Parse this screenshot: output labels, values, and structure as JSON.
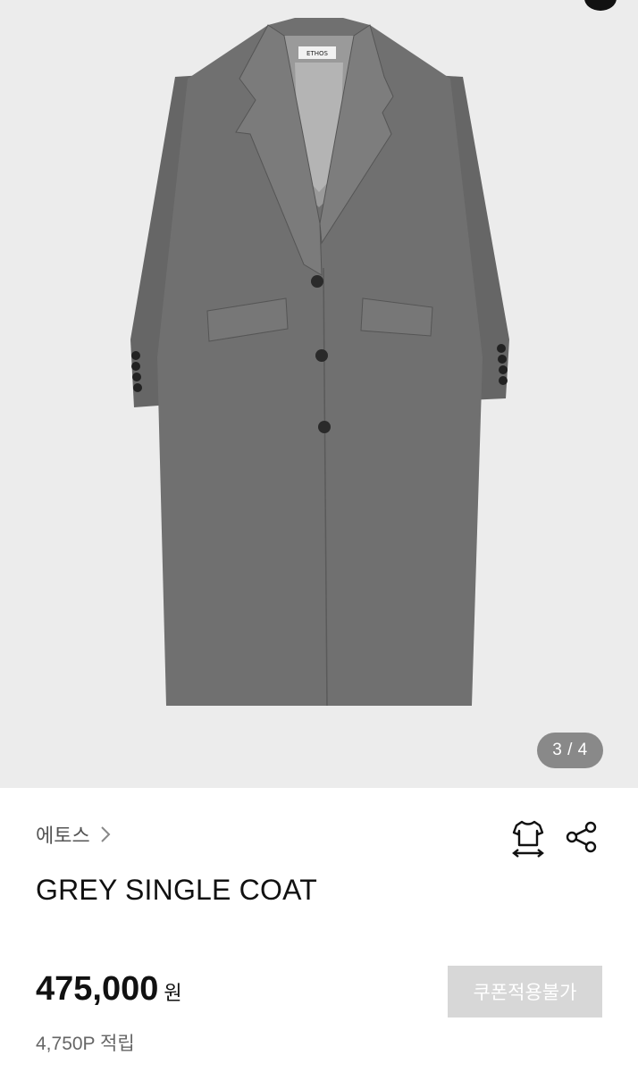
{
  "gallery": {
    "counter": "3 / 4",
    "label_text": "ETHOS"
  },
  "product": {
    "brand": "에토스",
    "title": "GREY SINGLE COAT",
    "price": "475,000",
    "currency": "원",
    "points": "4,750P 적립"
  },
  "actions": {
    "coupon_label": "쿠폰적용불가",
    "size_icon": "size-guide-icon",
    "share_icon": "share-icon"
  },
  "colors": {
    "hero_bg": "#ececec",
    "coat": "#6f6f6f",
    "coupon_disabled": "#d7d7d7"
  }
}
